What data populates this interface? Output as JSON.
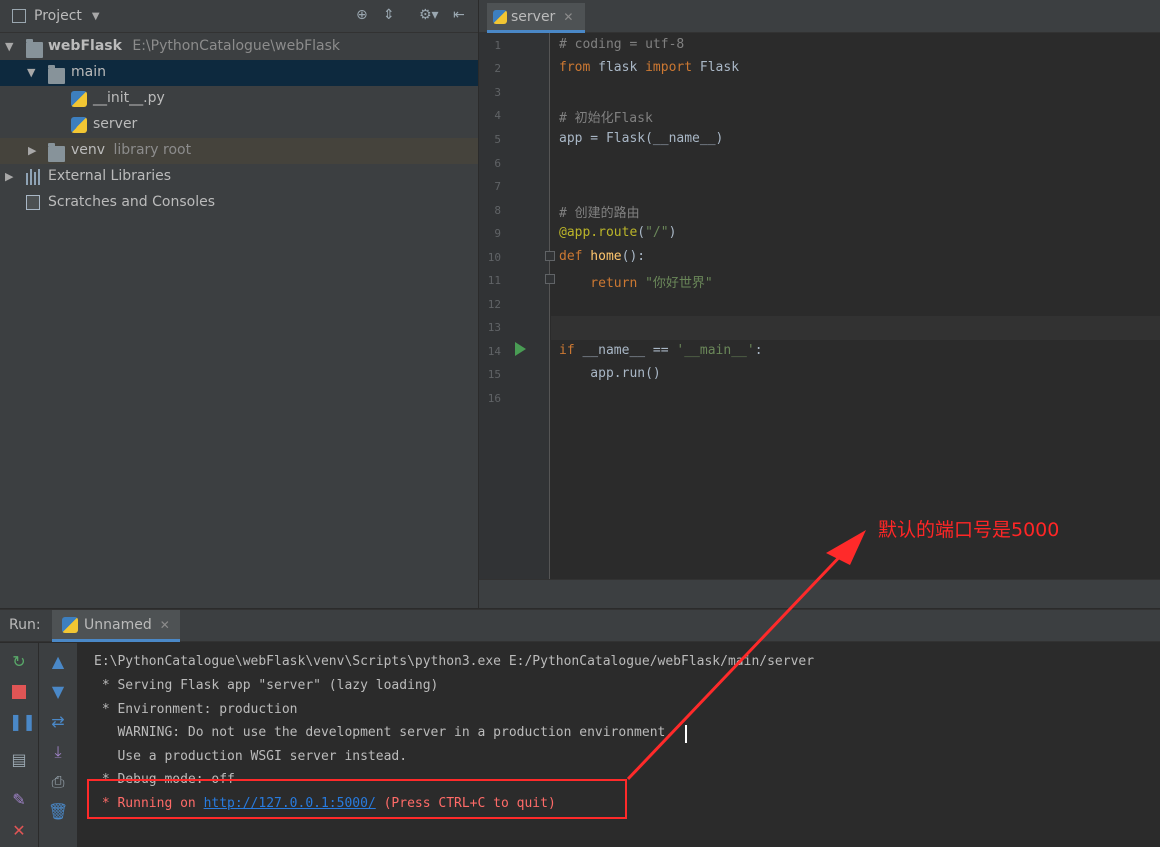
{
  "project_panel": {
    "title": "Project",
    "tree": {
      "root_name": "webFlask",
      "root_path": "E:\\PythonCatalogue\\webFlask",
      "main": "main",
      "init_file": "__init__.py",
      "server_file": "server",
      "venv": "venv",
      "venv_hint": "library root",
      "external_libraries": "External Libraries",
      "scratches": "Scratches and Consoles"
    }
  },
  "editor": {
    "tab_label": "server",
    "line_numbers": [
      "1",
      "2",
      "3",
      "4",
      "5",
      "6",
      "7",
      "8",
      "9",
      "10",
      "11",
      "12",
      "13",
      "14",
      "15",
      "16"
    ],
    "code": {
      "l1": "# coding = utf-8",
      "l2_kw1": "from",
      "l2_mid": " flask ",
      "l2_kw2": "import",
      "l2_end": " Flask",
      "l4": "# 初始化Flask",
      "l5": "app = Flask(__name__)",
      "l8": "# 创建的路由",
      "l9_dec": "@app.route",
      "l9_open": "(",
      "l9_str": "\"/\"",
      "l9_close": ")",
      "l10_kw": "def",
      "l10_fn": " home",
      "l10_end": "():",
      "l11_kw": "    return",
      "l11_str": " \"你好世界\"",
      "l14_kw": "if",
      "l14_mid": " __name__ == ",
      "l14_str": "'__main__'",
      "l14_end": ":",
      "l15": "    app.run()"
    }
  },
  "run_panel": {
    "label": "Run:",
    "tab_label": "Unnamed",
    "console": {
      "cmd": "E:\\PythonCatalogue\\webFlask\\venv\\Scripts\\python3.exe E:/PythonCatalogue/webFlask/main/server",
      "serving": " * Serving Flask app \"server\" (lazy loading)",
      "environment": " * Environment: production",
      "warning": "   WARNING: Do not use the development server in a production environment.",
      "use_wsgi": "   Use a production WSGI server instead.",
      "debug": " * Debug mode: off",
      "running_prefix": " * Running on ",
      "running_url": "http://127.0.0.1:5000/",
      "running_suffix": " (Press CTRL+C to quit)"
    }
  },
  "annotation": {
    "text": "默认的端口号是5000",
    "color": "#ff2a2a"
  }
}
